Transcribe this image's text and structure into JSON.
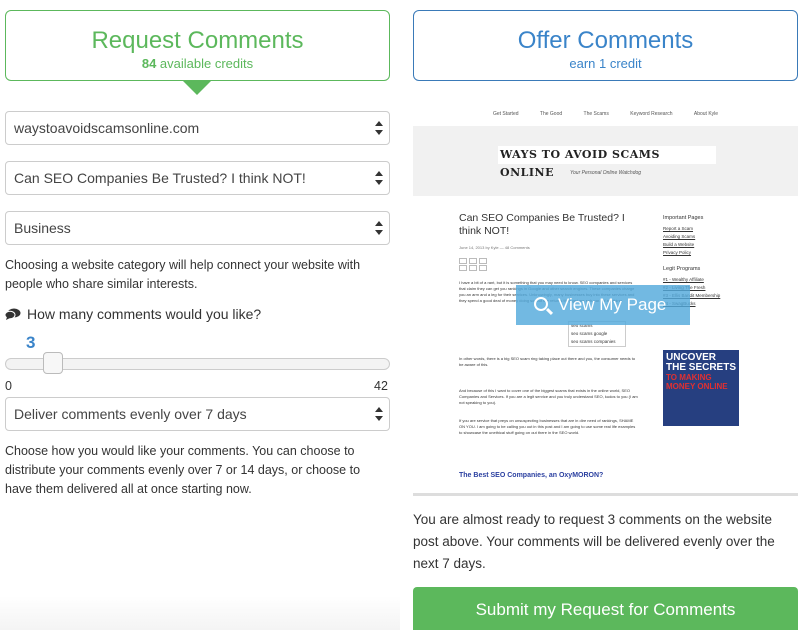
{
  "tabs": {
    "request": {
      "title": "Request Comments",
      "credits": "84",
      "credits_suffix": " available credits"
    },
    "offer": {
      "title": "Offer Comments",
      "subtitle": "earn 1 credit"
    }
  },
  "form": {
    "website": "waystoavoidscamsonline.com",
    "post": "Can SEO Companies Be Trusted? I think NOT!",
    "category": "Business",
    "category_help": "Choosing a website category will help connect your website with people who share similar interests.",
    "comments_question": "How many comments would you like?",
    "slider": {
      "value": "3",
      "min": "0",
      "max": "42",
      "fraction": 0.071
    },
    "delivery": "Deliver comments evenly over 7 days",
    "delivery_help": "Choose how you would like your comments. You can choose to distribute your comments evenly over 7 or 14 days, or choose to have them delivered all at once starting now."
  },
  "preview": {
    "nav": [
      "Get Started",
      "The Good",
      "The Scams",
      "Keyword Research",
      "About Kyle"
    ],
    "logo": "WAYS TO AVOID SCAMS ONLINE",
    "tagline": "Your Personal Online Watchdog",
    "post_title": "Can SEO Companies Be Trusted? I think NOT!",
    "meta": "June 14, 2013 by Kyle — 48 Comments",
    "para1": "I have a bit of a rant, but it is something that you may need to know. SEO companies and services that claim they can get you rankings in Google and other search engines. These companies charge you an arm and a leg for their services. Unknowingly, many businesses buy into these services and they spend a good deal of money doing so, but the returns they get are sub-par... if anything.",
    "para2": "In other words, there is a big SEO scam ring taking place out there and you, the consumer needs to be aware of this.",
    "para3": "And because of this I want to cover one of the biggest scams that exists in the online world, SEO Companies and Services. If you are a legit service and you truly understand SEO, kudos to you (I am not speaking to you).",
    "para4": "If you are service that preys on unsuspecting businesses that are in dire need of rankings, SHAME ON YOU. I am going to be calling you out in this post and I am going to use some real life examples to showcase the unethical stuff going on out there in the SEO world.",
    "subhead": "The Best SEO Companies, an OxyMORON?",
    "sidebar_heading": "Important Pages",
    "sidebar_links": [
      "Report a Scam",
      "Avoiding Scams",
      "Build a Website",
      "Privacy Policy"
    ],
    "sidebar_heading2": "Legit Programs",
    "sidebar_links2": [
      "#1 - Wealthy Affiliate",
      "#2 - Living The Fresh",
      "#3 - Ellis Bandit Membership",
      "#4 - SwagBucks"
    ],
    "suggest": [
      "seo scams",
      "seo scams google",
      "seo scams companies"
    ],
    "ad": [
      "UNCOVER",
      "THE SECRETS",
      "TO MAKING",
      "MONEY ONLINE"
    ],
    "view_button": "View My Page"
  },
  "summary": "You are almost ready to request 3 comments on the website post above. Your comments will be delivered evenly over the next 7 days.",
  "submit_label": "Submit my Request for Comments"
}
